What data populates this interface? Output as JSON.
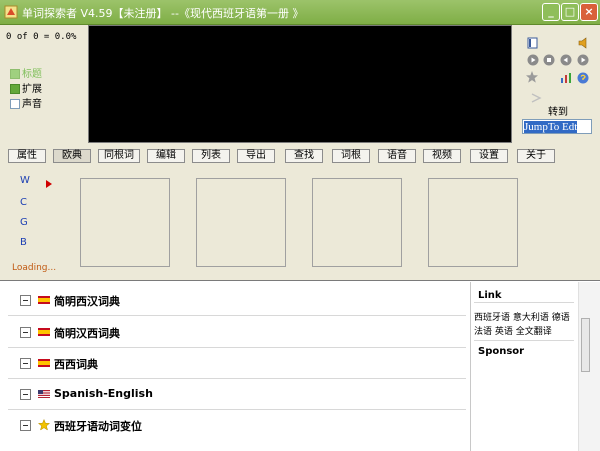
{
  "window": {
    "title": "单词探索者 V4.59【未注册】 --《现代西班牙语第一册 》",
    "min_glyph": "_",
    "max_glyph": "□",
    "close_glyph": "×"
  },
  "status": {
    "counter": "0 of 0 = 0.0%"
  },
  "options": [
    {
      "label": "标题",
      "state": "dim"
    },
    {
      "label": "扩展",
      "state": "on"
    },
    {
      "label": "声音",
      "state": "off"
    }
  ],
  "nav": {
    "goto_label": "转到",
    "jump_value": "JumpTo Edt"
  },
  "toolbar": [
    "属性",
    "欧典",
    "同根词",
    "编辑",
    "列表",
    "导出",
    "查找",
    "词根",
    "语音",
    "视频",
    "设置",
    "关于"
  ],
  "letters": [
    "W",
    "C",
    "G",
    "B"
  ],
  "loading_text": "Loading...",
  "dictionaries": [
    {
      "label": "简明西汉词典",
      "flag": "es"
    },
    {
      "label": "简明汉西词典",
      "flag": "es"
    },
    {
      "label": "西西词典",
      "flag": "es"
    },
    {
      "label": "Spanish-English",
      "flag": "us"
    },
    {
      "label": "西班牙语动词变位",
      "flag": "star"
    }
  ],
  "side": {
    "link_title": "Link",
    "link_line1": "西班牙语 意大利语 德语",
    "link_line2": "法语 英语 全文翻译",
    "sponsor_title": "Sponsor"
  },
  "colors": {
    "titlebar": "#8fbe5a",
    "accent_blue": "#316ac5",
    "loading": "#c15b14"
  }
}
